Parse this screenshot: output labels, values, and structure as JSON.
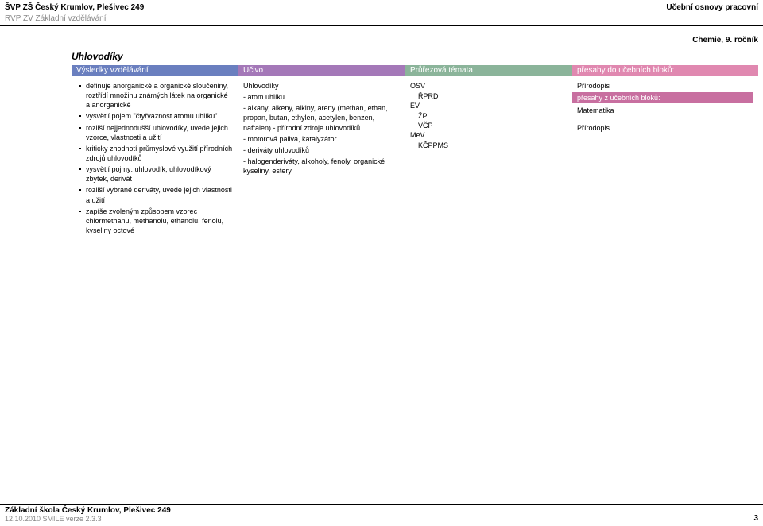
{
  "header": {
    "left": "ŠVP ZŠ Český Krumlov, Plešivec 249",
    "right": "Učební osnovy pracovní",
    "sub": "RVP ZV Základní vzdělávání",
    "subject": "Chemie, 9. ročník"
  },
  "section": {
    "title": "Uhlovodíky"
  },
  "columns": {
    "h1": "Výsledky vzdělávání",
    "h2": "Učivo",
    "h3": "Průřezová témata",
    "h4": "přesahy do učebních bloků:"
  },
  "outcomes": [
    "definuje anorganické a organické sloučeniny, roztřídí množinu známých látek na organické a anorganické",
    "vysvětlí pojem \"čtyřvaznost atomu uhlíku\"",
    "rozliší nejjednodušší uhlovodíky, uvede jejich vzorce, vlastnosti a užití",
    "kriticky zhodnotí průmyslové využití přírodních zdrojů uhlovodíků",
    "vysvětlí pojmy: uhlovodík, uhlovodíkový zbytek, derivát",
    "rozliší vybrané deriváty, uvede jejich vlastnosti a užití",
    "zapíše zvoleným způsobem vzorec chlormethanu, methanolu, ethanolu, fenolu, kyseliny octové"
  ],
  "curriculum": {
    "title": "Uhlovodíky",
    "l1": "- atom uhlíku",
    "l2": "- alkany, alkeny, alkiny, areny (methan, ethan, propan, butan, ethylen, acetylen, benzen, naftalen) - přírodní zdroje uhlovodíků",
    "l3": "- motorová paliva, katalyzátor",
    "l4": "- deriváty uhlovodíků",
    "l5": "- halogenderiváty, alkoholy, fenoly, organické kyseliny, estery"
  },
  "topics": {
    "t1": "OSV",
    "t1a": "ŘPRD",
    "t2": "EV",
    "t2a": "ŽP",
    "t2b": "VČP",
    "t3": "MeV",
    "t3a": "KČPPMS"
  },
  "overlaps": {
    "into1": "Přírodopis",
    "fromHeader": "přesahy z učebních bloků:",
    "from1": "Matematika",
    "from2": "Přírodopis"
  },
  "footer": {
    "school": "Základní škola Český Krumlov, Plešivec 249",
    "meta": "12.10.2010 SMILE verze 2.3.3",
    "page": "3"
  }
}
